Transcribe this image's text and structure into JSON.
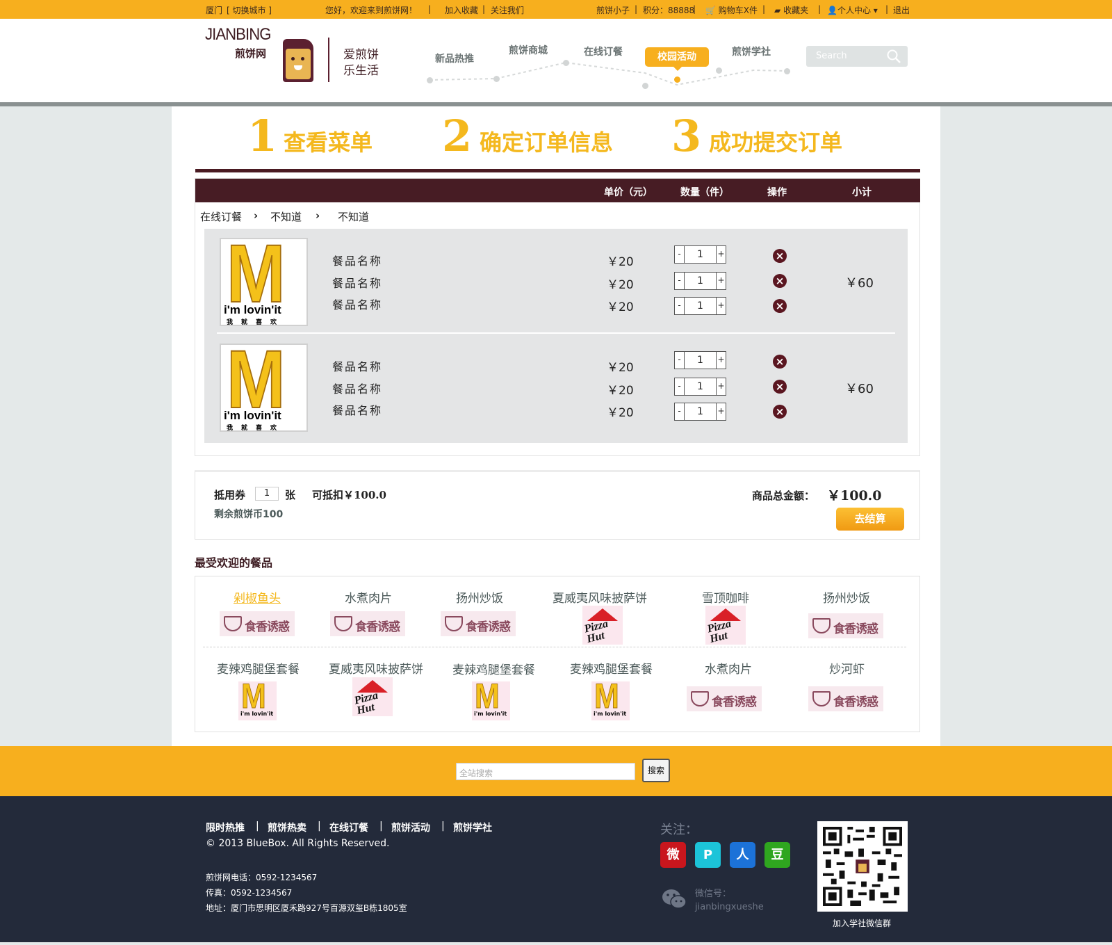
{
  "topbar": {
    "city": "厦门",
    "switch_city": "[ 切换城市 ]",
    "welcome": "您好，欢迎来到煎饼网！",
    "add_favorite": "加入收藏",
    "follow_us": "关注我们",
    "username": "煎饼小子",
    "points": "积分：88888",
    "cart": "购物车X件",
    "favorites": "收藏夹",
    "user_center": "个人中心",
    "logout": "退出"
  },
  "header": {
    "logo_en": "JIANBING",
    "logo_cn": "煎饼网",
    "slogan_1": "爱煎饼",
    "slogan_2": "乐生活",
    "nav": [
      "新品热推",
      "煎饼商城",
      "在线订餐",
      "校园活动",
      "煎饼学社"
    ],
    "active_nav": "校园活动",
    "search_placeholder": "Search"
  },
  "steps": [
    {
      "num": "1",
      "label": "查看菜单"
    },
    {
      "num": "2",
      "label": "确定订单信息"
    },
    {
      "num": "3",
      "label": "成功提交订单"
    }
  ],
  "table": {
    "headers": [
      "单价（元）",
      "数量（件）",
      "操作",
      "小计"
    ],
    "breadcrumb": [
      "在线订餐",
      "不知道",
      "不知道"
    ],
    "groups": [
      {
        "logo_tagline": "i'm lovin'it",
        "logo_sub": "我就喜欢",
        "items": [
          {
            "name": "餐品名称",
            "price": "￥20",
            "qty": "1"
          },
          {
            "name": "餐品名称",
            "price": "￥20",
            "qty": "1"
          },
          {
            "name": "餐品名称",
            "price": "￥20",
            "qty": "1"
          }
        ],
        "subtotal": "￥60"
      },
      {
        "logo_tagline": "i'm lovin'it",
        "logo_sub": "我就喜欢",
        "items": [
          {
            "name": "餐品名称",
            "price": "￥20",
            "qty": "1"
          },
          {
            "name": "餐品名称",
            "price": "￥20",
            "qty": "1"
          },
          {
            "name": "餐品名称",
            "price": "￥20",
            "qty": "1"
          }
        ],
        "subtotal": "￥60"
      }
    ],
    "minus": "-",
    "plus": "+",
    "delete": "×"
  },
  "summary": {
    "coupon_label": "抵用券",
    "coupon_value": "1",
    "coupon_unit": "张",
    "deductible": "可抵扣￥100.0",
    "remaining": "剩余煎饼币100",
    "total_label": "商品总金额：",
    "total_value": "￥100.0",
    "checkout": "去结算"
  },
  "popular": {
    "title": "最受欢迎的餐品",
    "row1": [
      {
        "name": "剁椒鱼头",
        "logo": "bowl-brand"
      },
      {
        "name": "水煮肉片",
        "logo": "bowl-brand"
      },
      {
        "name": "扬州炒饭",
        "logo": "bowl-brand"
      },
      {
        "name": "夏威夷风味披萨饼",
        "logo": "pizza-hut"
      },
      {
        "name": "雪顶咖啡",
        "logo": "pizza-hut"
      },
      {
        "name": "扬州炒饭",
        "logo": "bowl-brand"
      }
    ],
    "row2": [
      {
        "name": "麦辣鸡腿堡套餐",
        "logo": "mcdonalds"
      },
      {
        "name": "夏威夷风味披萨饼",
        "logo": "pizza-hut"
      },
      {
        "name": "麦辣鸡腿堡套餐",
        "logo": "mcdonalds"
      },
      {
        "name": "麦辣鸡腿堡套餐",
        "logo": "mcdonalds"
      },
      {
        "name": "水煮肉片",
        "logo": "bowl-brand"
      },
      {
        "name": "炒河虾",
        "logo": "bowl-brand"
      }
    ],
    "bowl_text": "食香诱惑",
    "pizza_text": "Pizza Hut",
    "mcd_tag": "i'm lovin'it"
  },
  "footer_search": {
    "placeholder": "全站搜索",
    "button": "搜索"
  },
  "footer": {
    "links": [
      "限时热推",
      "煎饼热卖",
      "在线订餐",
      "煎饼活动",
      "煎饼学社"
    ],
    "copyright": "© 2013 BlueBox.  All Rights Reserved.",
    "phone": "煎饼网电话：0592-1234567",
    "fax": "传真：0592-1234567",
    "address": "地址：厦门市思明区厦禾路927号百源双玺B栋1805室",
    "follow": "关注：",
    "social": [
      {
        "name": "weibo",
        "glyph": "微",
        "color": "#c9161d"
      },
      {
        "name": "qzone",
        "glyph": "P",
        "color": "#1cc4d9"
      },
      {
        "name": "renren",
        "glyph": "人",
        "color": "#1c72d8"
      },
      {
        "name": "douban",
        "glyph": "豆",
        "color": "#2fa61f"
      }
    ],
    "wechat_label": "微信号：",
    "wechat_id": "jianbingxueshe",
    "qr_caption": "加入学社微信群"
  }
}
